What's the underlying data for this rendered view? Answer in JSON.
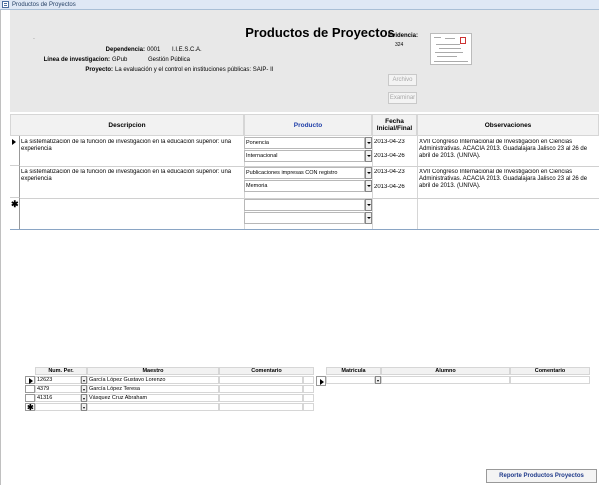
{
  "window": {
    "title": "Productos de Proyectos"
  },
  "header": {
    "title": "Productos de Proyectos",
    "mark": ".",
    "dependencia_label": "Dependencia:",
    "dependencia_code": "0001",
    "dependencia_name": "I.I.E.S.C.A.",
    "linea_label": "Línea de investigacion:",
    "linea_code": "GPub",
    "linea_name": "Gestión Pública",
    "proyecto_label": "Proyecto:",
    "proyecto_name": "La evaluación y el control en instituciones públicas: SAIP- II",
    "evidencia_label": "Evidencia:",
    "evidencia_num": "324",
    "archivo_button": "Archivo",
    "examinar_button": "Examinar"
  },
  "grid": {
    "columns": [
      "Descripcion",
      "Producto",
      "Fecha Inicial/Final",
      "Observaciones"
    ],
    "rows": [
      {
        "descripcion": "La sistematización de la función de investigación en la educación superior: una experiencia",
        "producto": "Ponencia",
        "producto2": "Internacional",
        "fecha_inicial": "2013-04-23",
        "fecha_final": "2013-04-26",
        "observaciones": "XVII Congreso Internacional de Investigación en Ciencias Administrativas. ACACIA 2013. Guadalajara Jalisco 23 al 26 de abril de 2013. (UNIVA)."
      },
      {
        "descripcion": "La sistematización de la función de investigación en la educación superior: una experiencia",
        "producto": "Publicaciones impresas CON registro",
        "producto2": "Memoria",
        "fecha_inicial": "2013-04-23",
        "fecha_final": "2013-04-26",
        "observaciones": "XVII Congreso Internacional de Investigación en Ciencias Administrativas. ACACIA 2013. Guadalajara Jalisco 23 al 26 de abril de 2013. (UNIVA)."
      }
    ]
  },
  "maestros": {
    "columns": [
      "Num. Per.",
      "Maestro",
      "Comentario"
    ],
    "rows": [
      {
        "num": "12623",
        "maestro": "García López Gustavo Lorenzo"
      },
      {
        "num": "4379",
        "maestro": "García López Teresa"
      },
      {
        "num": "41316",
        "maestro": "Vásquez Cruz Abraham"
      }
    ]
  },
  "alumnos": {
    "columns": [
      "Matricula",
      "Alumno",
      "Comentario"
    ]
  },
  "footer": {
    "report_button": "Reporte Productos Proyectos"
  }
}
